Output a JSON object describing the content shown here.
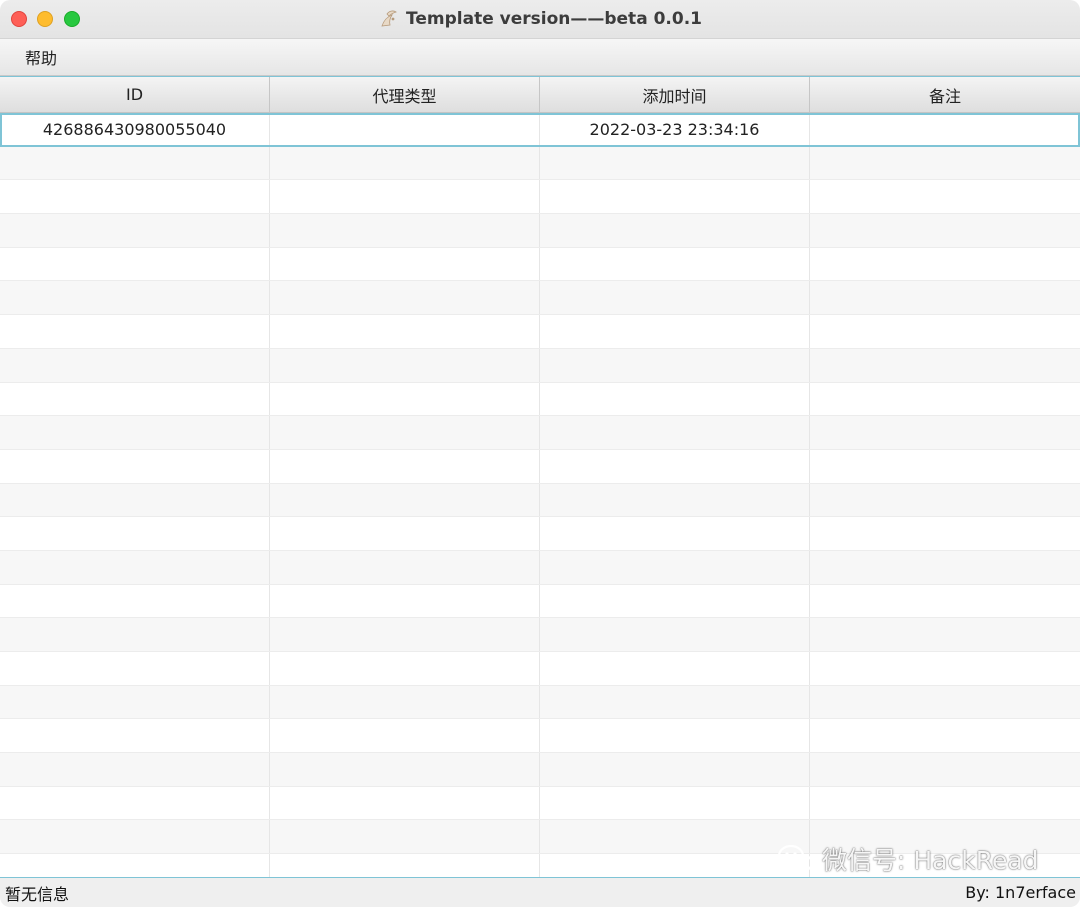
{
  "window": {
    "title": "Template version——beta 0.0.1"
  },
  "menu": {
    "items": [
      {
        "label": "帮助"
      }
    ]
  },
  "table": {
    "columns": [
      "ID",
      "代理类型",
      "添加时间",
      "备注"
    ],
    "rows": [
      {
        "id": "426886430980055040",
        "proxy_type": "",
        "added_time": "2022-03-23 23:34:16",
        "note": ""
      }
    ]
  },
  "status": {
    "left_text": "暂无信息",
    "right_text": "By: 1n7erface"
  },
  "watermark": {
    "text": "微信号: HackRead"
  },
  "colors": {
    "selection_border": "#7fc4d6",
    "traffic_close": "#fe5f57",
    "traffic_minimize": "#febc2e",
    "traffic_maximize": "#28c840"
  }
}
